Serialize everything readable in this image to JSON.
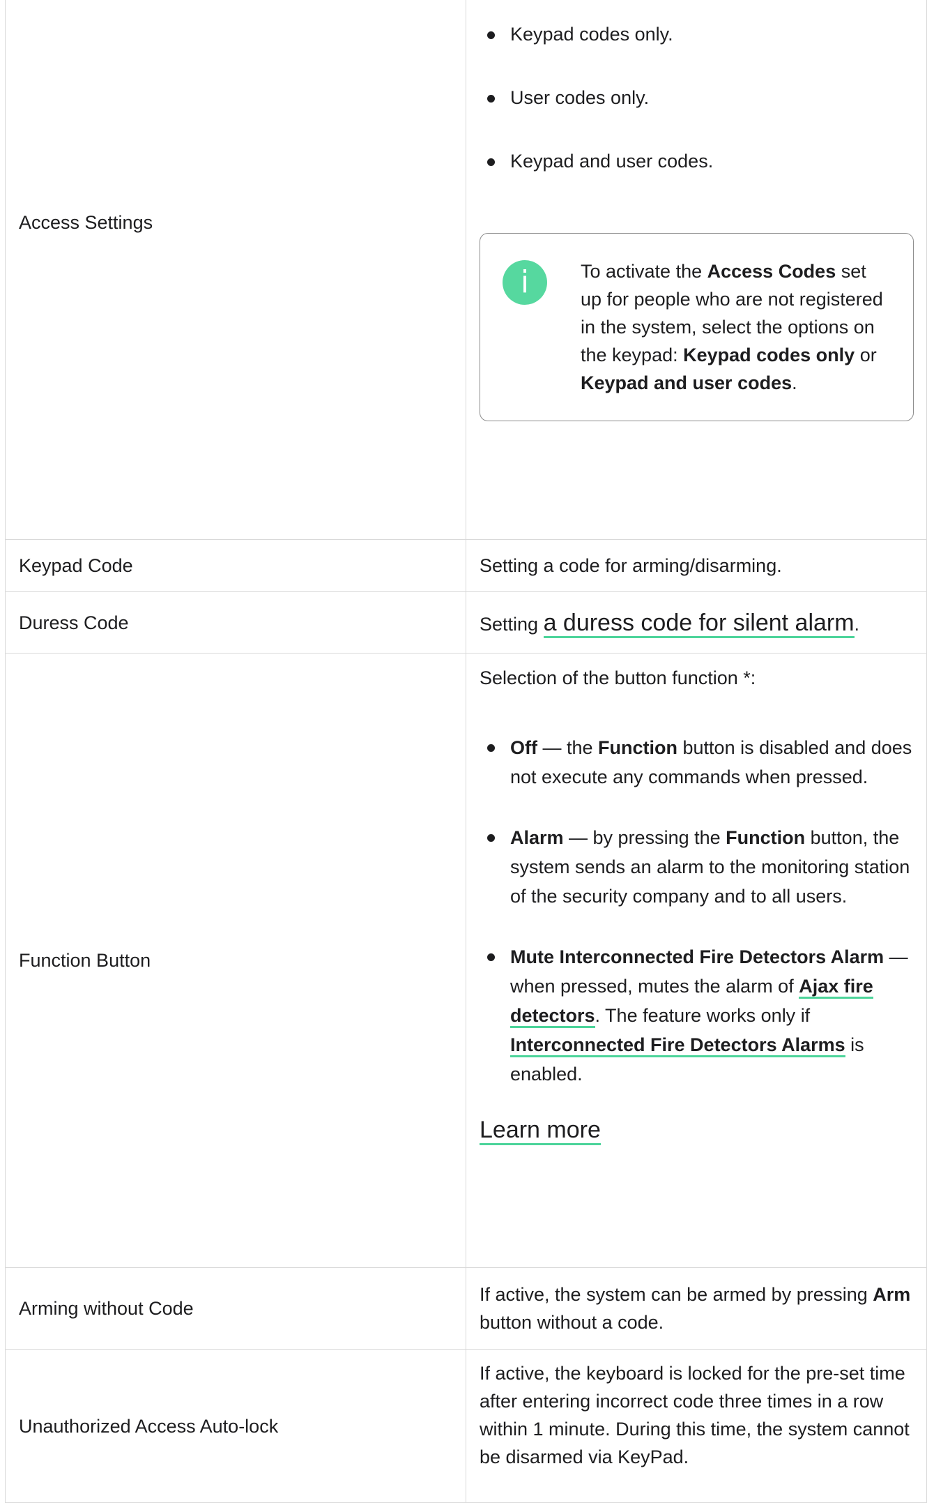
{
  "colors": {
    "accent": "#4cd49a",
    "info_icon_bg": "#56d89f",
    "border": "#d9d9d9"
  },
  "rows": {
    "access_settings": {
      "label": "Access Settings",
      "options": [
        "Keypad codes only.",
        "User codes only.",
        "Keypad and user codes."
      ],
      "info": {
        "icon": "info-icon",
        "icon_glyph": "i",
        "t1": "To activate the ",
        "b1": "Access Codes",
        "t2": " set up for people who are not registered in the system, select the options on the keypad: ",
        "b2": "Keypad codes only",
        "t3": " or ",
        "b3": "Keypad and user codes",
        "t4": "."
      }
    },
    "keypad_code": {
      "label": "Keypad Code",
      "desc": "Setting a code for arming/disarming."
    },
    "duress_code": {
      "label": "Duress Code",
      "desc_prefix": "Setting ",
      "link": "a duress code for silent alarm",
      "desc_suffix": "."
    },
    "function_button": {
      "label": "Function Button",
      "intro": "Selection of the button function *:",
      "items": [
        {
          "b1": "Off",
          "t1": " — the ",
          "b2": "Function",
          "t2": " button is disabled and does not execute any commands when pressed."
        },
        {
          "b1": "Alarm",
          "t1": " — by pressing the ",
          "b2": "Function",
          "t2": " button, the system sends an alarm to the monitoring station of the security company and to all users."
        },
        {
          "b1": "Mute Interconnected Fire Detectors Alarm",
          "t1": " — when pressed, mutes the alarm of ",
          "link1": "Ajax fire detectors",
          "t2": ". The feature works only if ",
          "link2": "Interconnected Fire Detectors Alarms",
          "t3": " is enabled."
        }
      ],
      "learn_more": "Learn more"
    },
    "arming_without_code": {
      "label": "Arming without Code",
      "t1": "If active, the system can be armed by pressing ",
      "b1": "Arm",
      "t2": " button without a code."
    },
    "auto_lock": {
      "label": "Unauthorized Access Auto-lock",
      "desc": "If active, the keyboard is locked for the pre-set time after entering incorrect code three times in a row within 1 minute. During this time, the system cannot be disarmed via KeyPad."
    }
  }
}
